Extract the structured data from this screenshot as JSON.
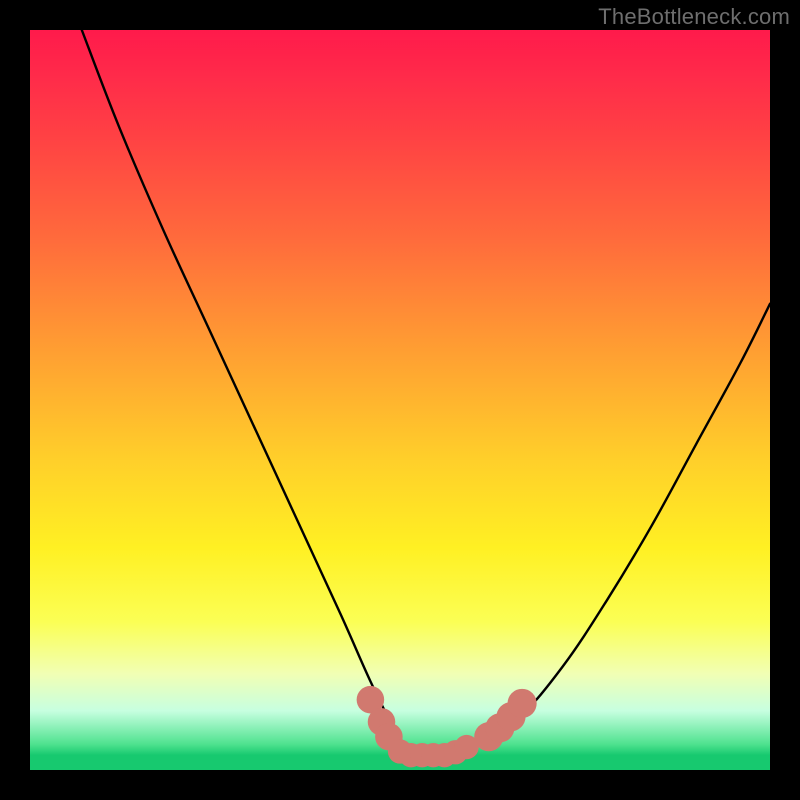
{
  "watermark": "TheBottleneck.com",
  "chart_data": {
    "type": "line",
    "title": "",
    "xlabel": "",
    "ylabel": "",
    "xlim": [
      0,
      100
    ],
    "ylim": [
      0,
      100
    ],
    "series": [
      {
        "name": "curve",
        "color": "#000000",
        "x": [
          7,
          12,
          18,
          24,
          30,
          36,
          42,
          46,
          49,
          51,
          53,
          56,
          60,
          66,
          72,
          78,
          84,
          90,
          96,
          100
        ],
        "values": [
          100,
          87,
          73,
          60,
          47,
          34,
          21,
          12,
          6,
          3,
          2,
          2,
          3,
          7,
          14,
          23,
          33,
          44,
          55,
          63
        ]
      }
    ],
    "markers": {
      "name": "bottom-markers",
      "color": "#d1796f",
      "points": [
        {
          "x": 46.0,
          "y": 9.5,
          "r": 1.2
        },
        {
          "x": 47.5,
          "y": 6.5,
          "r": 1.2
        },
        {
          "x": 48.5,
          "y": 4.5,
          "r": 1.2
        },
        {
          "x": 50.0,
          "y": 2.5,
          "r": 1.0
        },
        {
          "x": 51.5,
          "y": 2.0,
          "r": 1.0
        },
        {
          "x": 53.0,
          "y": 2.0,
          "r": 1.0
        },
        {
          "x": 54.5,
          "y": 2.0,
          "r": 1.0
        },
        {
          "x": 56.0,
          "y": 2.0,
          "r": 1.0
        },
        {
          "x": 57.5,
          "y": 2.4,
          "r": 1.0
        },
        {
          "x": 59.0,
          "y": 3.1,
          "r": 1.0
        },
        {
          "x": 62.0,
          "y": 4.5,
          "r": 1.3
        },
        {
          "x": 63.5,
          "y": 5.7,
          "r": 1.3
        },
        {
          "x": 65.0,
          "y": 7.2,
          "r": 1.3
        },
        {
          "x": 66.5,
          "y": 9.0,
          "r": 1.3
        }
      ]
    }
  }
}
